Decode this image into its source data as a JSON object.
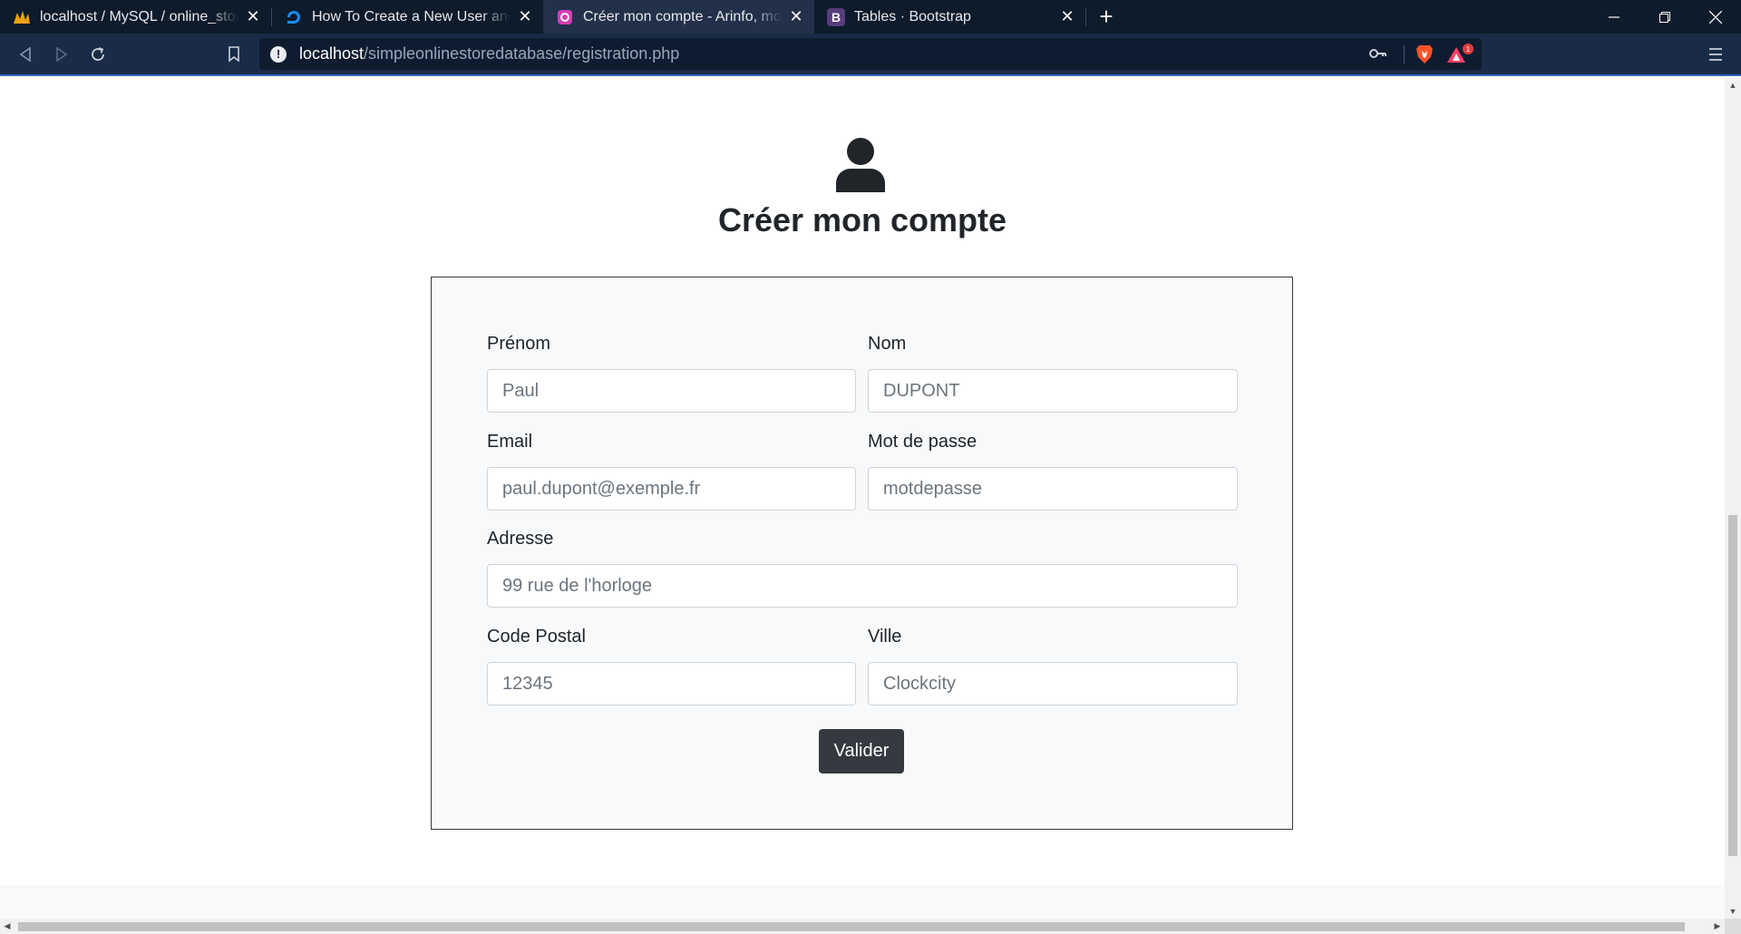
{
  "browser": {
    "tabs": [
      {
        "title": "localhost / MySQL / online_store /",
        "icon": "phpmyadmin-icon",
        "active": false
      },
      {
        "title": "How To Create a New User and Gr",
        "icon": "digitalocean-icon",
        "active": false
      },
      {
        "title": "Créer mon compte - Arinfo, montr",
        "icon": "site-favicon-icon",
        "active": true
      },
      {
        "title": "Tables · Bootstrap",
        "icon": "bootstrap-icon",
        "active": false
      }
    ],
    "bootstrap_favicon_letter": "B",
    "url_host": "localhost",
    "url_path": "/simpleonlinestoredatabase/registration.php",
    "rewards_badge": "1"
  },
  "page": {
    "title": "Créer mon compte",
    "form": {
      "firstname": {
        "label": "Prénom",
        "placeholder": "Paul"
      },
      "lastname": {
        "label": "Nom",
        "placeholder": "DUPONT"
      },
      "email": {
        "label": "Email",
        "placeholder": "paul.dupont@exemple.fr"
      },
      "password": {
        "label": "Mot de passe",
        "placeholder": "motdepasse"
      },
      "address": {
        "label": "Adresse",
        "placeholder": "99 rue de l'horloge"
      },
      "postal_code": {
        "label": "Code Postal",
        "placeholder": "12345"
      },
      "city": {
        "label": "Ville",
        "placeholder": "Clockcity"
      },
      "submit_label": "Valider"
    }
  },
  "colors": {
    "tabbar_bg": "#0d1b2a",
    "toolbar_bg": "#1a2b47",
    "form_bg": "#f8f9fa",
    "button_dark": "#343a40",
    "text_dark": "#212529"
  }
}
